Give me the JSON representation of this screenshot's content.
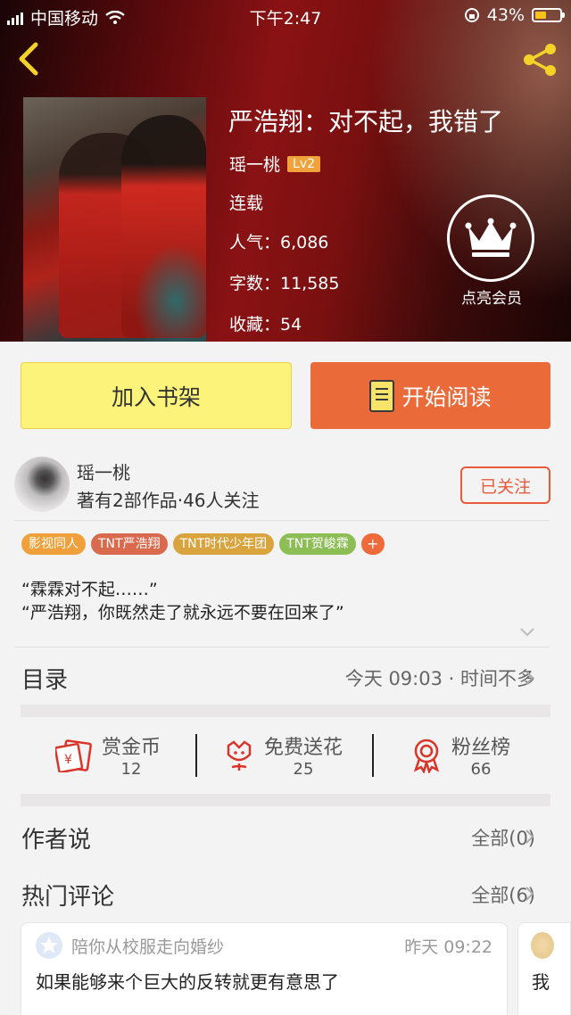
{
  "status_bar": {
    "carrier": "中国移动",
    "time": "下午2:47",
    "battery": "43%"
  },
  "book": {
    "title": "严浩翔：对不起，我错了",
    "author": "瑶一桃",
    "level": "Lv2",
    "status": "连载",
    "popularity": "人气：6,086",
    "word_count": "字数：11,585",
    "favorites": "收藏：54",
    "vip_label": "点亮会员"
  },
  "actions": {
    "add_shelf": "加入书架",
    "start_reading": "开始阅读"
  },
  "author_card": {
    "name": "瑶一桃",
    "stats": "著有2部作品·46人关注",
    "follow_label": "已关注"
  },
  "tags": [
    {
      "label": "影视同人",
      "color": "#f0a03a"
    },
    {
      "label": "TNT严浩翔",
      "color": "#d96a4e"
    },
    {
      "label": "TNT时代少年团",
      "color": "#d9a43e"
    },
    {
      "label": "TNT贺峻霖",
      "color": "#8dbd55"
    },
    {
      "label": "+",
      "color": "#ee6a3a"
    }
  ],
  "intro": [
    "“霖霖对不起……”",
    "“严浩翔，你既然走了就永远不要在回来了”"
  ],
  "catalog": {
    "label": "目录",
    "update": "今天 09:03 · 时间不多"
  },
  "stats": [
    {
      "label": "赏金币",
      "value": "12"
    },
    {
      "label": "免费送花",
      "value": "25"
    },
    {
      "label": "粉丝榜",
      "value": "66"
    }
  ],
  "author_says": {
    "label": "作者说",
    "count": "全部(0)"
  },
  "hot_comments": {
    "label": "热门评论",
    "count": "全部(6)"
  },
  "comments": [
    {
      "user": "陪你从校服走向婚纱",
      "time": "昨天 09:22",
      "text": "如果能够来个巨大的反转就更有意思了"
    },
    {
      "text": "我"
    }
  ],
  "accent": "#e85a3a"
}
